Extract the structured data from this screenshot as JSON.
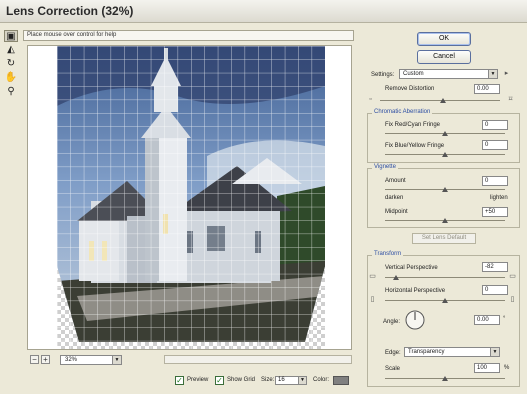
{
  "window": {
    "title": "Lens Correction (32%)"
  },
  "toolbox": {
    "tools": [
      "remove-distortion-tool",
      "straighten-tool",
      "move-grid-tool",
      "hand-tool",
      "zoom-tool"
    ]
  },
  "hint": "Place mouse over control for help",
  "preview": {
    "zoom": "32%",
    "grid_cell": "#ffffff"
  },
  "options": {
    "preview_label": "Preview",
    "preview_checked": true,
    "grid_label": "Show Grid",
    "grid_checked": true,
    "size_label": "Size:",
    "size_value": "16",
    "color_label": "Color:",
    "color_value": "#808080"
  },
  "buttons": {
    "ok": "OK",
    "cancel": "Cancel",
    "set_default": "Set Lens Default"
  },
  "settings": {
    "label": "Settings:",
    "value": "Custom",
    "remove_distortion_label": "Remove Distortion",
    "remove_distortion_value": "0.00"
  },
  "chromatic": {
    "title": "Chromatic Aberration",
    "red_cyan_label": "Fix Red/Cyan Fringe",
    "red_cyan_value": "0",
    "blue_yellow_label": "Fix Blue/Yellow Fringe",
    "blue_yellow_value": "0"
  },
  "vignette": {
    "title": "Vignette",
    "amount_label": "Amount",
    "amount_value": "0",
    "darken_label": "darken",
    "lighten_label": "lighten",
    "midpoint_label": "Midpoint",
    "midpoint_value": "+50"
  },
  "transform": {
    "title": "Transform",
    "vertical_label": "Vertical Perspective",
    "vertical_value": "-82",
    "horizontal_label": "Horizontal Perspective",
    "horizontal_value": "0",
    "angle_label": "Angle:",
    "angle_value": "0.00",
    "angle_unit": "°",
    "edge_label": "Edge:",
    "edge_value": "Transparency",
    "scale_label": "Scale",
    "scale_value": "100",
    "scale_unit": "%"
  }
}
